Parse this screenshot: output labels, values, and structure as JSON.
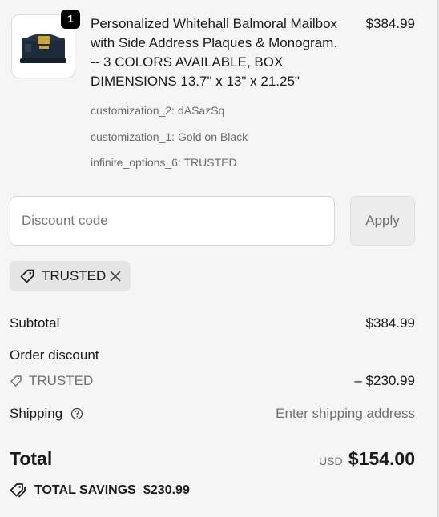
{
  "line_item": {
    "quantity": "1",
    "title_lines": [
      "Personalized Whitehall Balmoral Mailbox",
      "with Side Address Plaques & Monogram.",
      "-- 3 COLORS AVAILABLE, BOX",
      "DIMENSIONS 13.7\" x 13\" x 21.25\""
    ],
    "price": "$384.99",
    "options": [
      "customization_2: dASazSq",
      "customization_1: Gold on Black",
      "infinite_options_6: TRUSTED"
    ],
    "thumbnail_icon": "mailbox-image"
  },
  "discount": {
    "placeholder": "Discount code",
    "apply_label": "Apply",
    "applied_code": "TRUSTED"
  },
  "summary": {
    "subtotal_label": "Subtotal",
    "subtotal_value": "$384.99",
    "order_discount_label": "Order discount",
    "discount_code": "TRUSTED",
    "discount_value": "– $230.99",
    "shipping_label": "Shipping",
    "shipping_value": "Enter shipping address",
    "total_label": "Total",
    "currency": "USD",
    "total_value": "$154.00",
    "savings_label": "TOTAL SAVINGS",
    "savings_value": "$230.99"
  },
  "colors": {
    "background": "#f5f5f5",
    "muted_text": "#707070",
    "badge": "#000000"
  }
}
